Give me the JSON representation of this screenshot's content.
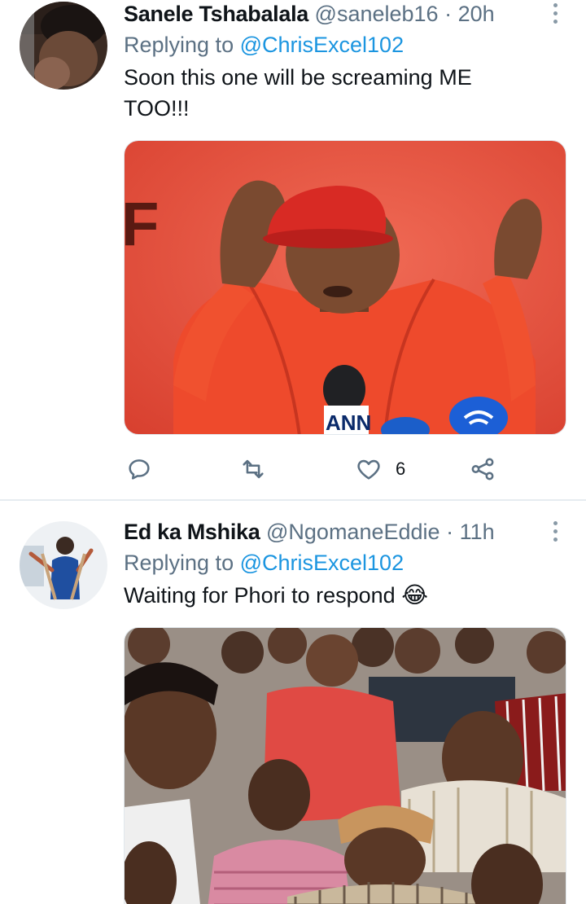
{
  "tweets": [
    {
      "name": "Sanele Tshabalala",
      "handle": "@saneleb16",
      "separator": "·",
      "time": "20h",
      "replying_prefix": "Replying to",
      "replying_to": "@ChrisExcel102",
      "text_line1": "Soon this one will be screaming ME",
      "text_line2": "TOO!!!",
      "actions": {
        "reply_count": "",
        "retweet_count": "",
        "like_count": "6"
      },
      "media": {
        "background": "#e9513f",
        "logo_letter": "F",
        "mic_label": "ANN"
      }
    },
    {
      "name": "Ed ka Mshika",
      "handle": "@NgomaneEddie",
      "separator": "·",
      "time": "11h",
      "replying_prefix": "Replying to",
      "replying_to": "@ChrisExcel102",
      "text": "Waiting for Phori to respond",
      "emoji": "😂"
    }
  ],
  "colors": {
    "accent": "#1b95e0",
    "secondary_text": "#5b7083",
    "divider": "#e6ecf0"
  }
}
